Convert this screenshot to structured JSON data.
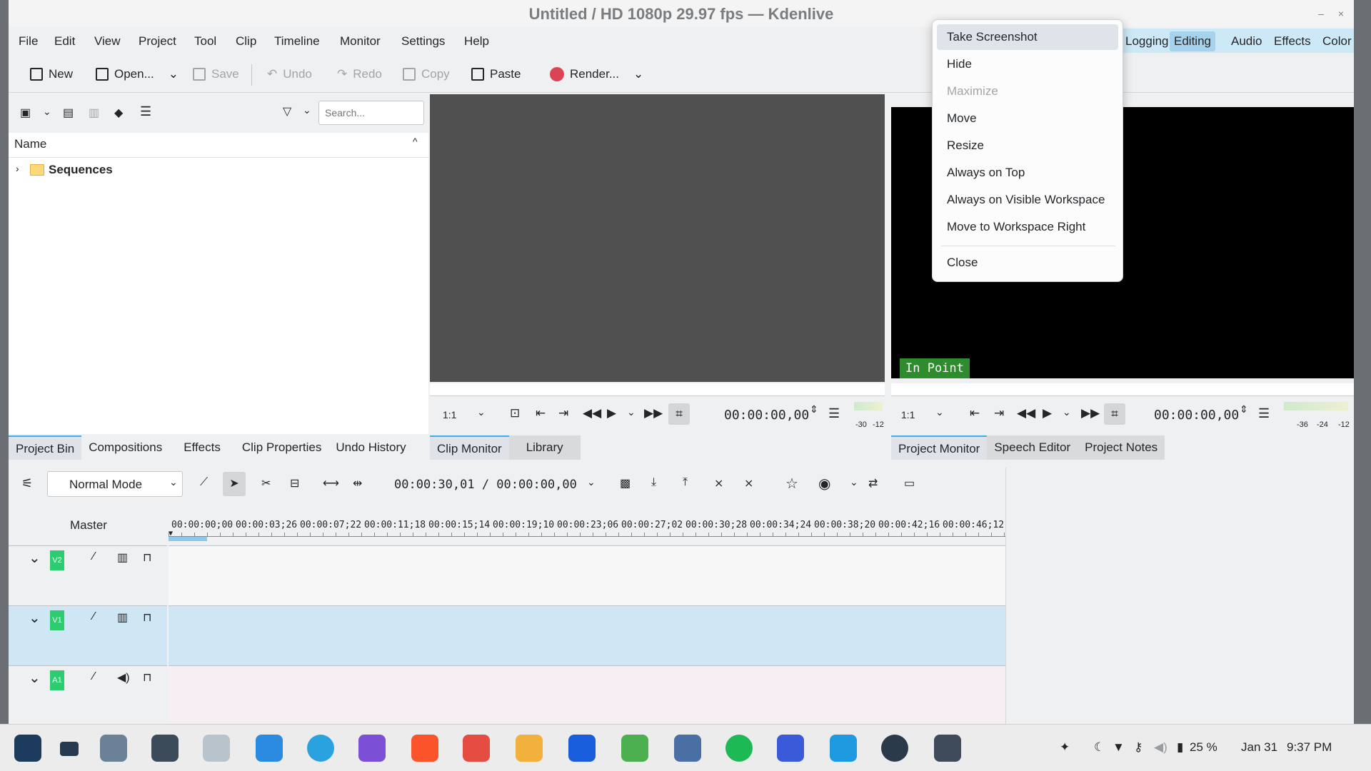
{
  "window": {
    "title": "Untitled / HD 1080p 29.97 fps — Kdenlive",
    "minimize": "–",
    "close": "×"
  },
  "menubar": [
    "File",
    "Edit",
    "View",
    "Project",
    "Tool",
    "Clip",
    "Timeline",
    "Monitor",
    "Settings",
    "Help"
  ],
  "workspaces": [
    "Logging",
    "Editing",
    "Audio",
    "Effects",
    "Color"
  ],
  "toolbar": {
    "new": "New",
    "open": "Open...",
    "save": "Save",
    "undo": "Undo",
    "redo": "Redo",
    "copy": "Copy",
    "paste": "Paste",
    "render": "Render..."
  },
  "bin": {
    "search_placeholder": "Search...",
    "column_name": "Name",
    "folder": "Sequences",
    "tabs": [
      "Project Bin",
      "Compositions",
      "Effects",
      "Clip Properties",
      "Undo History"
    ]
  },
  "clip_monitor": {
    "zoom": "1:1",
    "timecode": "00:00:00,00",
    "meter_labels": [
      "-30",
      "-12"
    ],
    "tabs": [
      "Clip Monitor",
      "Library"
    ]
  },
  "project_monitor": {
    "overlay": "In Point",
    "zoom": "1:1",
    "timecode": "00:00:00,00",
    "meter_labels": [
      "-36",
      "-24",
      "-12"
    ],
    "tabs": [
      "Project Monitor",
      "Speech Editor",
      "Project Notes"
    ]
  },
  "timeline": {
    "mode": "Normal Mode",
    "position": "00:00:30,01 / 00:00:00,00",
    "master": "Master",
    "ruler": [
      "00:00:00;00",
      "00:00:03;26",
      "00:00:07;22",
      "00:00:11;18",
      "00:00:15;14",
      "00:00:19;10",
      "00:00:23;06",
      "00:00:27;02",
      "00:00:30;28",
      "00:00:34;24",
      "00:00:38;20",
      "00:00:42;16",
      "00:00:46;12"
    ],
    "tracks": [
      "V2",
      "V1",
      "A1"
    ]
  },
  "window_menu": {
    "items": [
      "Take Screenshot",
      "Hide",
      "Maximize",
      "Move",
      "Resize",
      "Always on Top",
      "Always on Visible Workspace",
      "Move to Workspace Right",
      "Close"
    ]
  },
  "tray": {
    "battery": "25 %",
    "date": "Jan 31",
    "time": "9:37 PM"
  },
  "colors": {
    "accent": "#3daee9",
    "track_badge": "#2ecc71",
    "selected_track": "#cfe6f5",
    "in_point": "#2e8b2e"
  }
}
